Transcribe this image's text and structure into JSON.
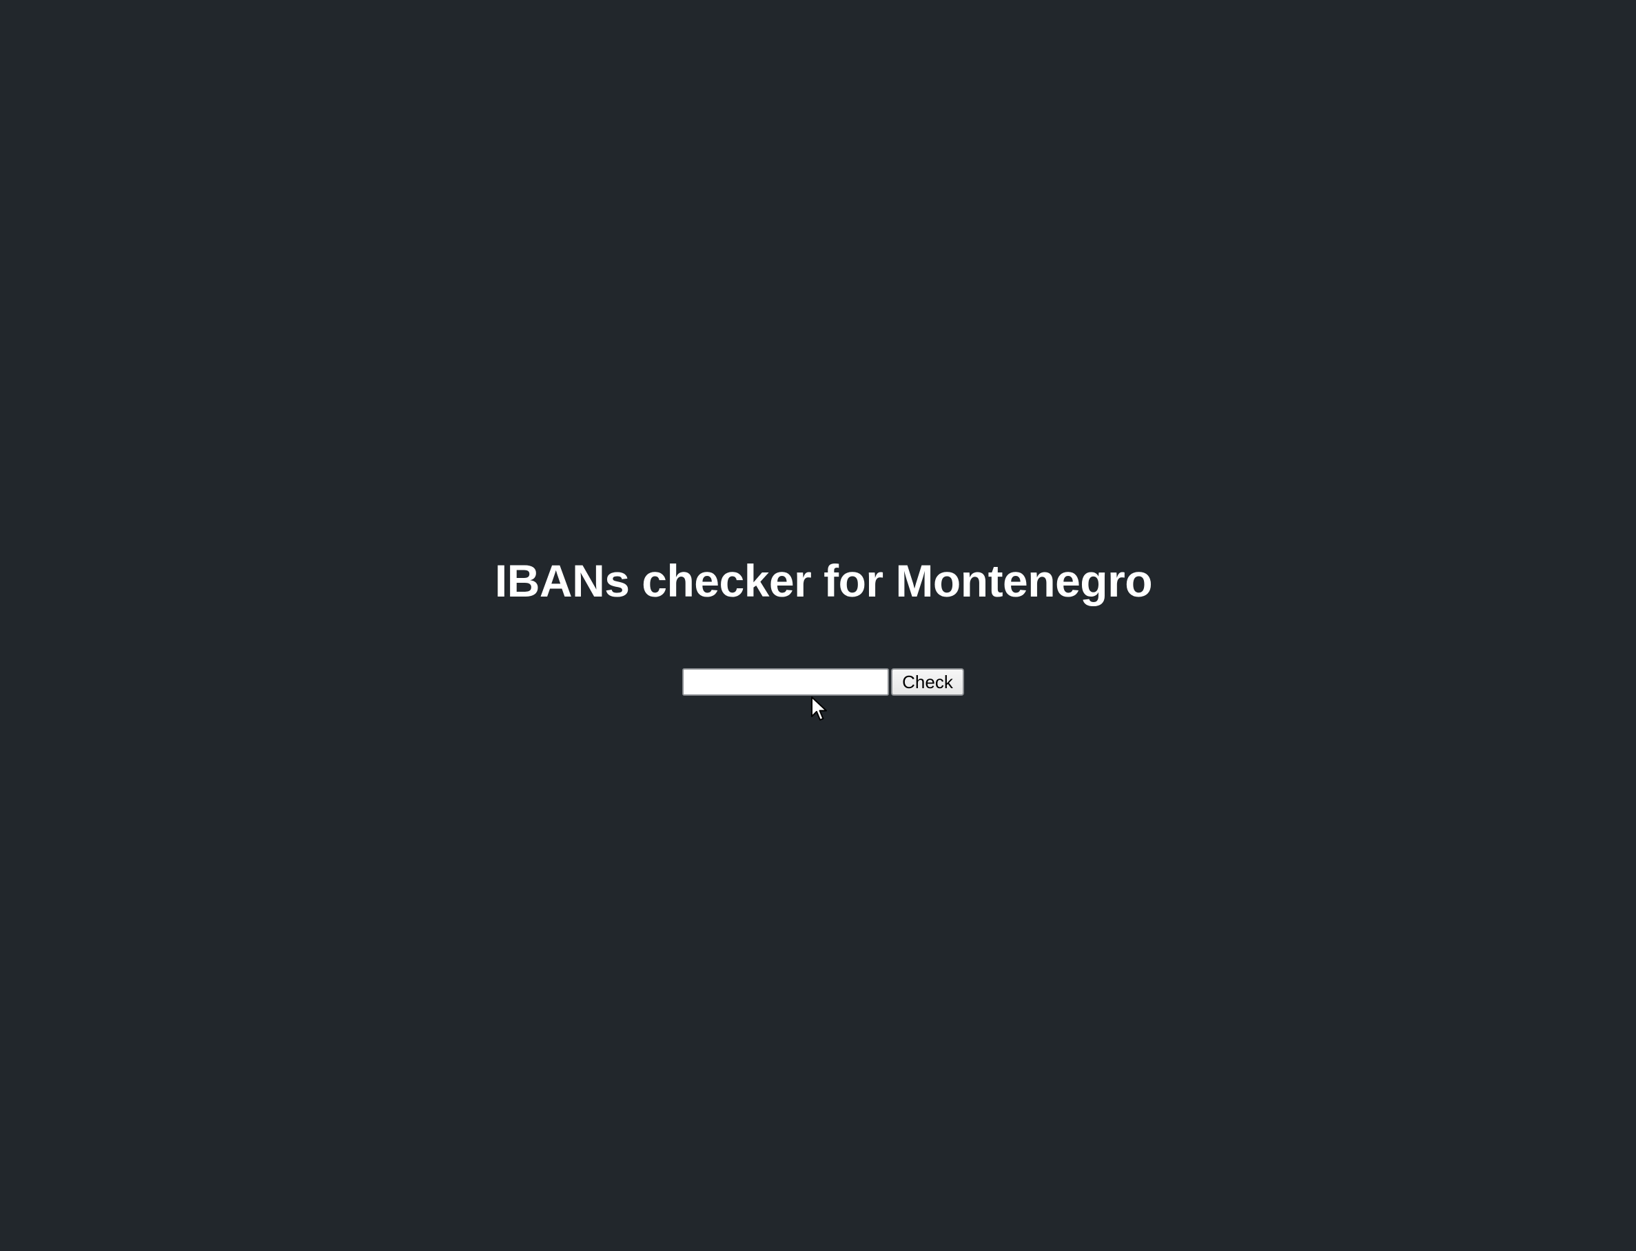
{
  "page": {
    "title": "IBANs checker for Montenegro"
  },
  "form": {
    "iban_input_value": "",
    "iban_input_placeholder": "",
    "check_label": "Check"
  },
  "icons": {
    "cursor": "mouse-pointer-icon"
  },
  "colors": {
    "background": "#22272c",
    "title": "#ffffff"
  }
}
